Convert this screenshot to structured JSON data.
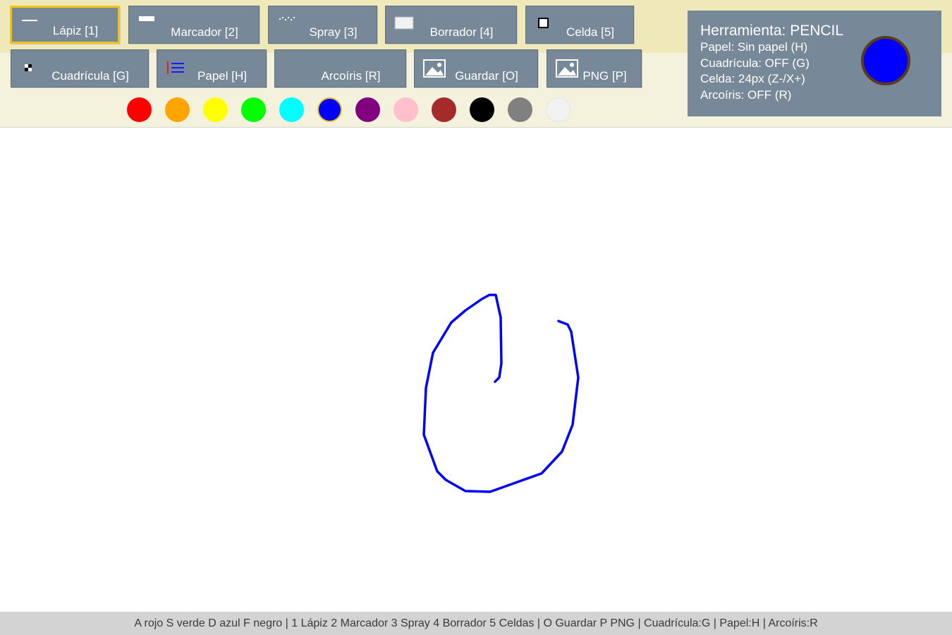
{
  "tools_row1": [
    {
      "name": "tool-pencil",
      "label": "Lápiz [1]",
      "icon": "pencil-line-icon",
      "active": true
    },
    {
      "name": "tool-marker",
      "label": "Marcador [2]",
      "icon": "marker-bar-icon",
      "active": false
    },
    {
      "name": "tool-spray",
      "label": "Spray [3]",
      "icon": "spray-dots-icon",
      "active": false
    },
    {
      "name": "tool-eraser",
      "label": "Borrador [4]",
      "icon": "eraser-icon",
      "active": false
    },
    {
      "name": "tool-cell",
      "label": "Celda [5]",
      "icon": "cell-square-icon",
      "active": false
    }
  ],
  "tools_row2": [
    {
      "name": "toggle-grid",
      "label": "Cuadrícula [G]",
      "icon": "checker-icon"
    },
    {
      "name": "toggle-paper",
      "label": "Papel [H]",
      "icon": "lined-paper-icon"
    },
    {
      "name": "toggle-rainbow",
      "label": "Arcoíris [R]",
      "icon": ""
    },
    {
      "name": "save",
      "label": "Guardar [O]",
      "icon": "image-icon"
    },
    {
      "name": "export-png",
      "label": "PNG [P]",
      "icon": "image-icon"
    }
  ],
  "palette": [
    "#ff0000",
    "#ffa500",
    "#ffff00",
    "#00ff00",
    "#00ffff",
    "#0000ff",
    "#800080",
    "#ffc0cb",
    "#a52a2a",
    "#000000",
    "#808080",
    "#f2f2f2"
  ],
  "selected_color": "#0000ff",
  "info": {
    "tool": "Herramienta: PENCIL",
    "paper": "Papel: Sin papel  (H)",
    "grid": "Cuadrícula: OFF  (G)",
    "cell": "Celda: 24px  (Z-/X+)",
    "rainbow": "Arcoíris: OFF  (R)"
  },
  "stroke_color": "#0000ff",
  "status_bar": "A rojo  S verde  D azul  F negro  |  1 Lápiz 2 Marcador 3 Spray 4 Borrador 5 Celdas  |  O Guardar  P PNG  |  Cuadrícula:G  |  Papel:H  |  Arcoíris:R"
}
